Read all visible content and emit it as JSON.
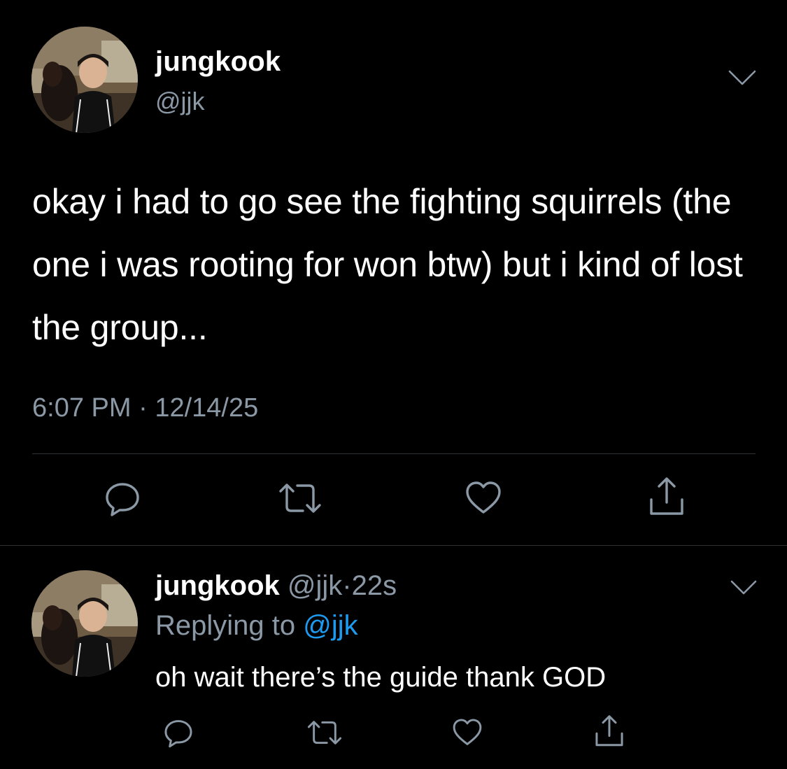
{
  "main_tweet": {
    "display_name": "jungkook",
    "handle": "@jjk",
    "text": "okay i had to go see the fighting squirrels (the one i was rooting for won btw) but i kind of lost the group...",
    "time": "6:07 PM",
    "separator": "·",
    "date": "12/14/25"
  },
  "reply_tweet": {
    "display_name": "jungkook",
    "handle": "@jjk",
    "separator": "·",
    "age": "22s",
    "replying_prefix": "Replying to",
    "replying_handle": "@jjk",
    "text": "oh wait there’s the guide thank GOD"
  },
  "icons": {
    "reply": "reply-bubble-icon",
    "retweet": "retweet-arrows-icon",
    "like": "heart-outline-icon",
    "share": "share-upload-icon",
    "more": "chevron-down-icon"
  },
  "colors": {
    "background": "#000000",
    "text_primary": "#ffffff",
    "text_secondary": "#8b98a5",
    "link": "#1d9bf0",
    "divider": "#2f3336"
  }
}
